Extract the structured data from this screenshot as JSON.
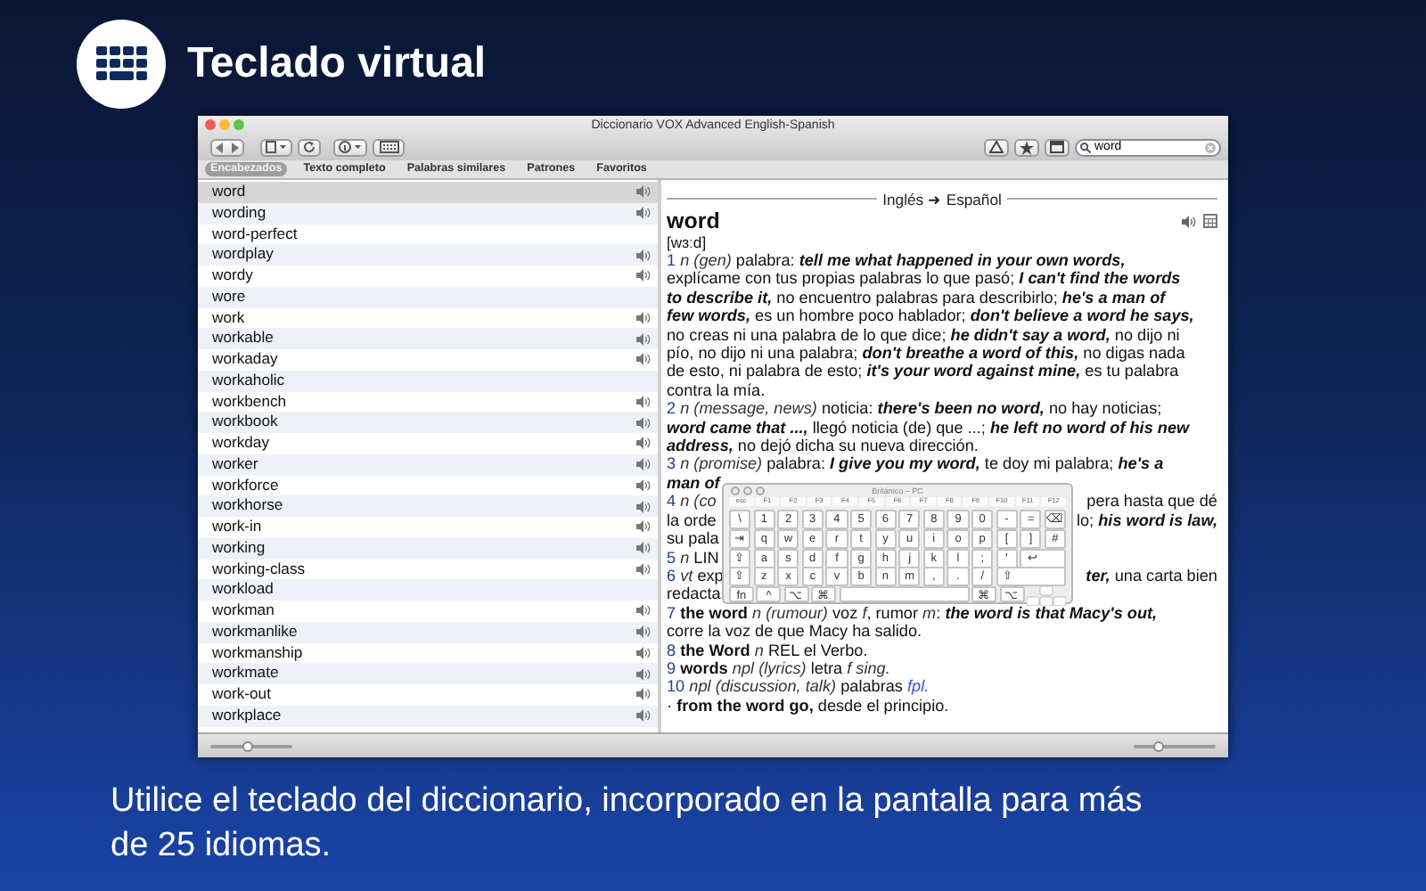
{
  "header": {
    "title": "Teclado virtual"
  },
  "window": {
    "title": "Diccionario VOX Advanced English-Spanish",
    "search": {
      "value": "word"
    }
  },
  "tabs": [
    {
      "label": "Encabezados",
      "selected": true
    },
    {
      "label": "Texto completo",
      "selected": false
    },
    {
      "label": "Palabras similares",
      "selected": false
    },
    {
      "label": "Patrones",
      "selected": false
    },
    {
      "label": "Favoritos",
      "selected": false
    }
  ],
  "word_list": [
    {
      "word": "word",
      "audio": true,
      "selected": true
    },
    {
      "word": "wording",
      "audio": true,
      "selected": false
    },
    {
      "word": "word-perfect",
      "audio": false,
      "selected": false
    },
    {
      "word": "wordplay",
      "audio": true,
      "selected": false
    },
    {
      "word": "wordy",
      "audio": true,
      "selected": false
    },
    {
      "word": "wore",
      "audio": false,
      "selected": false
    },
    {
      "word": "work",
      "audio": true,
      "selected": false
    },
    {
      "word": "workable",
      "audio": true,
      "selected": false
    },
    {
      "word": "workaday",
      "audio": true,
      "selected": false
    },
    {
      "word": "workaholic",
      "audio": false,
      "selected": false
    },
    {
      "word": "workbench",
      "audio": true,
      "selected": false
    },
    {
      "word": "workbook",
      "audio": true,
      "selected": false
    },
    {
      "word": "workday",
      "audio": true,
      "selected": false
    },
    {
      "word": "worker",
      "audio": true,
      "selected": false
    },
    {
      "word": "workforce",
      "audio": true,
      "selected": false
    },
    {
      "word": "workhorse",
      "audio": true,
      "selected": false
    },
    {
      "word": "work-in",
      "audio": true,
      "selected": false
    },
    {
      "word": "working",
      "audio": true,
      "selected": false
    },
    {
      "word": "working-class",
      "audio": true,
      "selected": false
    },
    {
      "word": "workload",
      "audio": false,
      "selected": false
    },
    {
      "word": "workman",
      "audio": true,
      "selected": false
    },
    {
      "word": "workmanlike",
      "audio": true,
      "selected": false
    },
    {
      "word": "workmanship",
      "audio": true,
      "selected": false
    },
    {
      "word": "workmate",
      "audio": true,
      "selected": false
    },
    {
      "word": "work-out",
      "audio": true,
      "selected": false
    },
    {
      "word": "workplace",
      "audio": true,
      "selected": false
    }
  ],
  "entry": {
    "direction": "Inglés ➜ Español",
    "headword": "word",
    "pronunciation": "[wɜːd]",
    "lines": [
      {
        "runs": [
          {
            "kind": "num",
            "text": "1"
          },
          {
            "kind": "ital",
            "text": " n (gen)"
          },
          {
            "kind": "plain",
            "text": " palabra: "
          },
          {
            "kind": "bi",
            "text": "tell me what happened in your own words,"
          }
        ]
      },
      {
        "runs": [
          {
            "kind": "plain",
            "text": "explícame con tus propias palabras lo que pasó; "
          },
          {
            "kind": "bi",
            "text": "I can't find the words"
          }
        ]
      },
      {
        "runs": [
          {
            "kind": "bi",
            "text": "to describe it,"
          },
          {
            "kind": "plain",
            "text": " no encuentro palabras para describirlo; "
          },
          {
            "kind": "bi",
            "text": "he's a man of"
          }
        ]
      },
      {
        "runs": [
          {
            "kind": "bi",
            "text": "few words,"
          },
          {
            "kind": "plain",
            "text": " es un hombre poco hablador; "
          },
          {
            "kind": "bi",
            "text": "don't believe a word he says,"
          }
        ]
      },
      {
        "runs": [
          {
            "kind": "plain",
            "text": "no creas ni una palabra de lo que dice; "
          },
          {
            "kind": "bi",
            "text": "he didn't say a word,"
          },
          {
            "kind": "plain",
            "text": " no dijo ni"
          }
        ]
      },
      {
        "runs": [
          {
            "kind": "plain",
            "text": "pío, no dijo ni una palabra; "
          },
          {
            "kind": "bi",
            "text": "don't breathe a word of this,"
          },
          {
            "kind": "plain",
            "text": " no digas nada"
          }
        ]
      },
      {
        "runs": [
          {
            "kind": "plain",
            "text": "de esto, ni palabra de esto; "
          },
          {
            "kind": "bi",
            "text": "it's your word against mine,"
          },
          {
            "kind": "plain",
            "text": " es tu palabra"
          }
        ]
      },
      {
        "runs": [
          {
            "kind": "plain",
            "text": "contra la mía."
          }
        ]
      },
      {
        "runs": [
          {
            "kind": "num",
            "text": "2"
          },
          {
            "kind": "ital",
            "text": " n (message, news)"
          },
          {
            "kind": "plain",
            "text": " noticia: "
          },
          {
            "kind": "bi",
            "text": "there's been no word,"
          },
          {
            "kind": "plain",
            "text": " no hay noticias;"
          }
        ]
      },
      {
        "runs": [
          {
            "kind": "bi",
            "text": "word came that ...,"
          },
          {
            "kind": "plain",
            "text": " llegó noticia (de) que ...; "
          },
          {
            "kind": "bi",
            "text": "he left no word of his new"
          }
        ]
      },
      {
        "runs": [
          {
            "kind": "bi",
            "text": "address,"
          },
          {
            "kind": "plain",
            "text": " no dejó dicha su nueva dirección."
          }
        ]
      },
      {
        "runs": [
          {
            "kind": "num",
            "text": "3"
          },
          {
            "kind": "ital",
            "text": " n (promise)"
          },
          {
            "kind": "plain",
            "text": " palabra: "
          },
          {
            "kind": "bi",
            "text": "I give you my word,"
          },
          {
            "kind": "plain",
            "text": " te doy mi palabra; "
          },
          {
            "kind": "bi",
            "text": "he's a"
          }
        ]
      },
      {
        "runs": [
          {
            "kind": "bi",
            "text": "man of"
          }
        ]
      },
      {
        "runs": [
          {
            "kind": "num",
            "text": "4"
          },
          {
            "kind": "ital",
            "text": " n (co"
          }
        ],
        "right": [
          {
            "kind": "plain",
            "text": "pera hasta que dé"
          }
        ]
      },
      {
        "runs": [
          {
            "kind": "plain",
            "text": "la orde"
          }
        ],
        "right": [
          {
            "kind": "plain",
            "text": "lo; "
          },
          {
            "kind": "bi",
            "text": "his word is law,"
          }
        ]
      },
      {
        "runs": [
          {
            "kind": "plain",
            "text": "su pala"
          }
        ]
      },
      {
        "runs": [
          {
            "kind": "num",
            "text": "5"
          },
          {
            "kind": "ital",
            "text": " n"
          },
          {
            "kind": "plain",
            "text": " LIN"
          }
        ]
      },
      {
        "runs": [
          {
            "kind": "num",
            "text": "6"
          },
          {
            "kind": "ital",
            "text": " vt"
          },
          {
            "kind": "plain",
            "text": " exp"
          }
        ],
        "right": [
          {
            "kind": "bi",
            "text": "ter,"
          },
          {
            "kind": "plain",
            "text": " una carta bien"
          }
        ]
      },
      {
        "runs": [
          {
            "kind": "plain",
            "text": "redacta"
          }
        ]
      },
      {
        "runs": [
          {
            "kind": "num",
            "text": "7"
          },
          {
            "kind": "bold",
            "text": " the word"
          },
          {
            "kind": "ital",
            "text": " n (rumour)"
          },
          {
            "kind": "plain",
            "text": " voz "
          },
          {
            "kind": "ital",
            "text": "f"
          },
          {
            "kind": "plain",
            "text": ", rumor "
          },
          {
            "kind": "ital",
            "text": "m"
          },
          {
            "kind": "plain",
            "text": ": "
          },
          {
            "kind": "bi",
            "text": "the word is that Macy's out,"
          }
        ]
      },
      {
        "runs": [
          {
            "kind": "plain",
            "text": "corre la voz de que Macy ha salido."
          }
        ]
      },
      {
        "runs": [
          {
            "kind": "num",
            "text": "8"
          },
          {
            "kind": "bold",
            "text": " the Word"
          },
          {
            "kind": "ital",
            "text": " n"
          },
          {
            "kind": "plain",
            "text": " REL el Verbo."
          }
        ]
      },
      {
        "runs": [
          {
            "kind": "num",
            "text": "9"
          },
          {
            "kind": "bold",
            "text": " words"
          },
          {
            "kind": "ital",
            "text": " npl (lyrics)"
          },
          {
            "kind": "plain",
            "text": " letra "
          },
          {
            "kind": "ital",
            "text": "f sing."
          }
        ]
      },
      {
        "runs": [
          {
            "kind": "num",
            "text": "10"
          },
          {
            "kind": "ital",
            "text": " npl (discussion, talk)"
          },
          {
            "kind": "plain",
            "text": " palabras "
          },
          {
            "kind": "link",
            "text": "fpl."
          }
        ]
      },
      {
        "runs": [
          {
            "kind": "plain",
            "text": "· "
          },
          {
            "kind": "bold",
            "text": "from the word go,"
          },
          {
            "kind": "plain",
            "text": " desde el principio."
          }
        ]
      }
    ]
  },
  "keyboard": {
    "title": "Británico – PC",
    "function_keys": [
      "esc",
      "F1",
      "F2",
      "F3",
      "F4",
      "F5",
      "F6",
      "F7",
      "F8",
      "F9",
      "F10",
      "F11",
      "F12"
    ],
    "rows": [
      [
        "\\",
        "1",
        "2",
        "3",
        "4",
        "5",
        "6",
        "7",
        "8",
        "9",
        "0",
        "-",
        "=",
        "⌫"
      ],
      [
        "⇥",
        "q",
        "w",
        "e",
        "r",
        "t",
        "y",
        "u",
        "i",
        "o",
        "p",
        "[",
        "]",
        "#"
      ],
      [
        "⇪",
        "a",
        "s",
        "d",
        "f",
        "g",
        "h",
        "j",
        "k",
        "l",
        ";",
        "'",
        "↩"
      ],
      [
        "⇧",
        "z",
        "x",
        "c",
        "v",
        "b",
        "n",
        "m",
        ",",
        ".",
        "/",
        "⇧"
      ]
    ],
    "bottom_row": {
      "left": [
        "fn",
        "^",
        "⌥",
        "⌘"
      ],
      "right": [
        "⌘",
        "⌥"
      ]
    }
  },
  "sliders": [
    {
      "level": 0.45
    },
    {
      "level": 0.3
    }
  ],
  "caption": "Utilice el teclado del diccionario, incorporado en la pantalla para más de 25 idiomas."
}
